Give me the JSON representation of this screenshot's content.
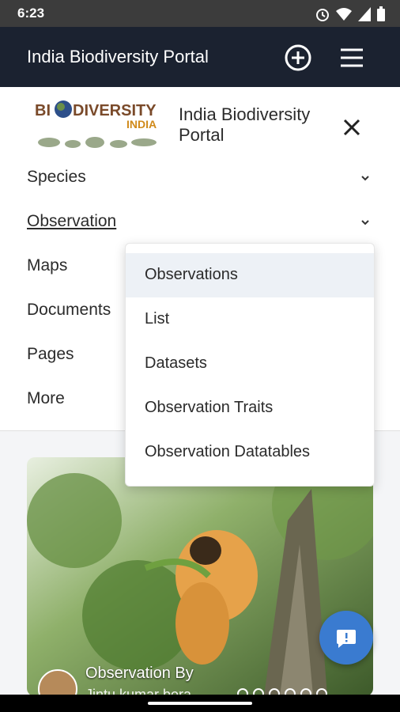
{
  "status": {
    "time": "6:23"
  },
  "appbar": {
    "title": "India Biodiversity Portal",
    "add_icon": "plus-circle-icon",
    "menu_icon": "hamburger-icon"
  },
  "brand": {
    "logo_text_top": "BIODIVERSITY",
    "logo_text_bottom": "INDIA",
    "name": "India Biodiversity Portal",
    "close_icon": "close-icon"
  },
  "nav": {
    "items": [
      {
        "label": "Species"
      },
      {
        "label": "Observation"
      },
      {
        "label": "Maps"
      },
      {
        "label": "Documents"
      },
      {
        "label": "Pages"
      },
      {
        "label": "More"
      }
    ]
  },
  "dropdown": {
    "items": [
      {
        "label": "Observations"
      },
      {
        "label": "List"
      },
      {
        "label": "Datasets"
      },
      {
        "label": "Observation Traits"
      },
      {
        "label": "Observation Datatables"
      }
    ]
  },
  "card": {
    "caption": "Observation By",
    "author": "Jintu kumar bora"
  },
  "colors": {
    "appbar": "#1b2230",
    "fab": "#3a7bd0",
    "dropdown_active": "#edf1f6"
  }
}
